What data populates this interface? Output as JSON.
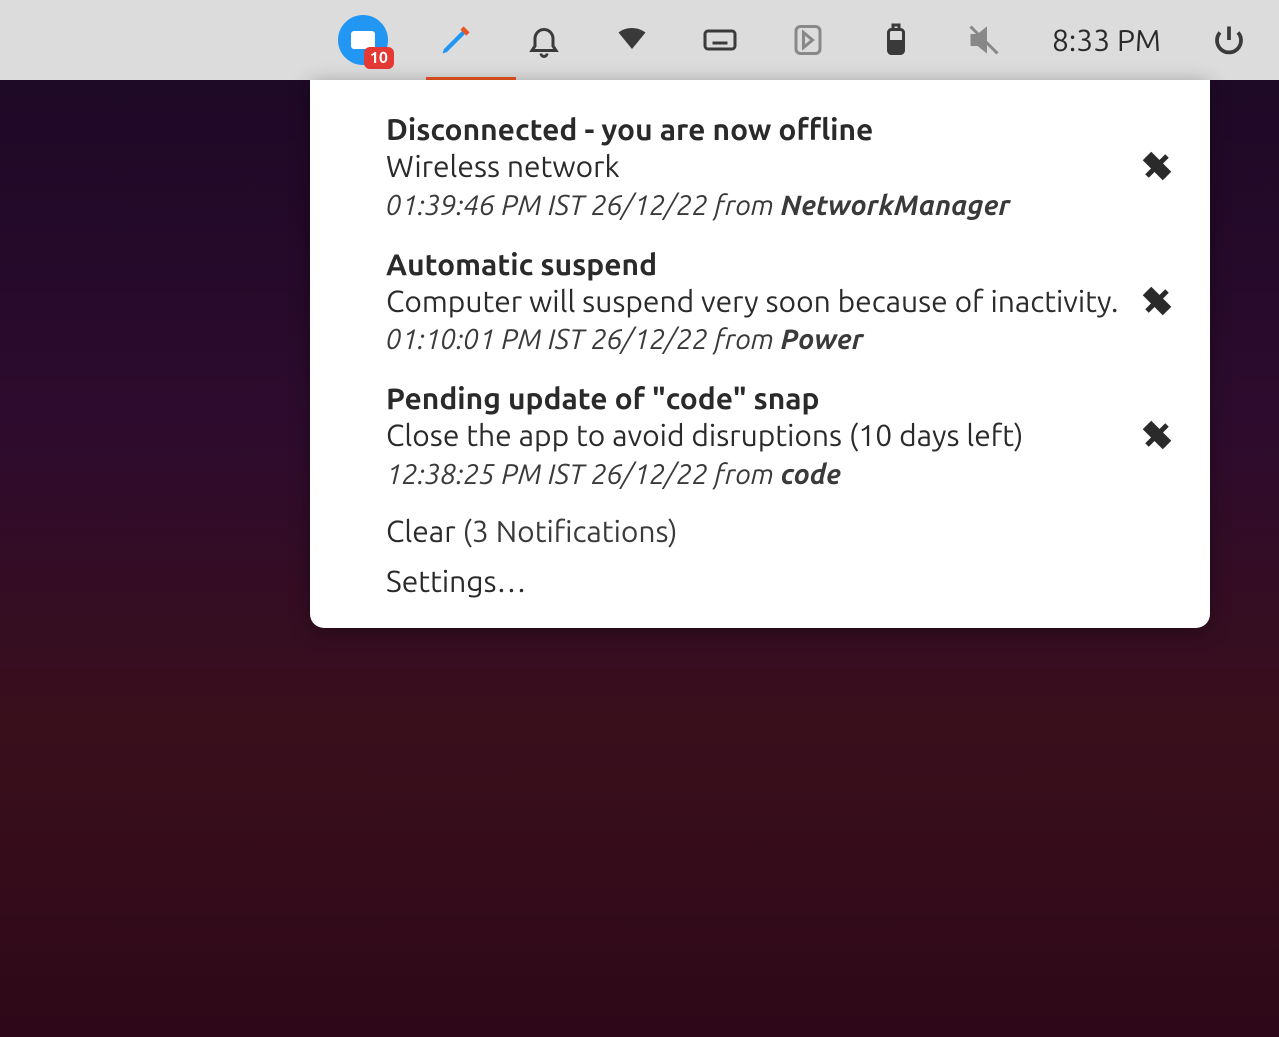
{
  "topbar": {
    "app_badge_count": "10",
    "clock": "8:33 PM"
  },
  "popup": {
    "notifications": [
      {
        "title": "Disconnected - you are now offline",
        "message": "Wireless network",
        "timestamp": "01:39:46 PM IST 26/12/22",
        "from_word": " from ",
        "source": "NetworkManager"
      },
      {
        "title": "Automatic suspend",
        "message": "Computer will suspend very soon because of inactivity.",
        "timestamp": "01:10:01 PM IST 26/12/22",
        "from_word": " from ",
        "source": "Power"
      },
      {
        "title": "Pending update of \"code\" snap",
        "message": "Close the app to avoid disruptions (10 days left)",
        "timestamp": "12:38:25 PM IST 26/12/22",
        "from_word": " from ",
        "source": "code"
      }
    ],
    "clear_label": "Clear",
    "clear_count": "(3 Notifications)",
    "settings_label": "Settings…"
  }
}
